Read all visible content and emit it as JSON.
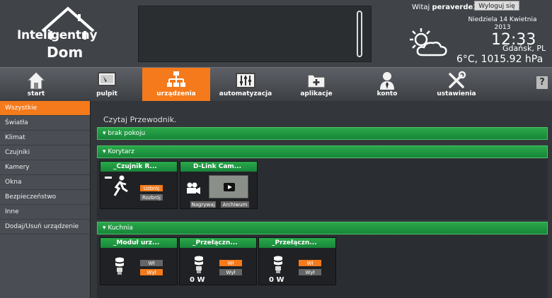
{
  "header": {
    "logo_line1": "Inteligentny",
    "logo_line2": "Dom",
    "welcome_prefix": "Witaj",
    "username": "peraverde1",
    "logout_label": "Wyloguj się",
    "date_line1": "Niedziela 14 Kwietnia",
    "date_line2": "2013",
    "time": "12:33",
    "city": "Gdańsk, PL",
    "weather": "6°C, 1015.92 hPa"
  },
  "nav": {
    "items": [
      {
        "label": "start",
        "icon": "home-icon"
      },
      {
        "label": "pulpit",
        "icon": "desktop-icon"
      },
      {
        "label": "urządzenia",
        "icon": "network-icon"
      },
      {
        "label": "automatyzacja",
        "icon": "sliders-icon"
      },
      {
        "label": "aplikacje",
        "icon": "folder-plus-icon"
      },
      {
        "label": "konto",
        "icon": "user-icon"
      },
      {
        "label": "ustawienia",
        "icon": "tools-icon"
      }
    ],
    "active": "urządzenia",
    "help": "?"
  },
  "sidebar": {
    "items": [
      "Wszystkie",
      "Światła",
      "Klimat",
      "Czujniki",
      "Kamery",
      "Okna",
      "Bezpieczeństwo",
      "Inne",
      "Dodaj/Usuń urządzenie"
    ],
    "active": "Wszystkie"
  },
  "main": {
    "intro": "Czytaj Przewodnik.",
    "groups": [
      {
        "title": "brak pokoju"
      },
      {
        "title": "Korytarz"
      },
      {
        "title": "Kuchnia"
      }
    ],
    "korytarz": {
      "sensor": {
        "title": "_Czujnik R...",
        "btn1": "Uzbrój",
        "btn2": "Rozbrój"
      },
      "camera": {
        "title": "D-Link Cam...",
        "btn1": "Nagrywaj",
        "btn2": "Archiwum"
      }
    },
    "kuchnia": [
      {
        "title": "_Moduł urz...",
        "on": "Wł",
        "off": "Wył",
        "power": ""
      },
      {
        "title": "_Przełączn...",
        "on": "Wł",
        "off": "Wył",
        "power": "0 W"
      },
      {
        "title": "_Przełączn...",
        "on": "Wł",
        "off": "Wył",
        "power": "0 W"
      }
    ]
  },
  "colors": {
    "accent": "#f47a1b",
    "green": "#2aa84a"
  }
}
